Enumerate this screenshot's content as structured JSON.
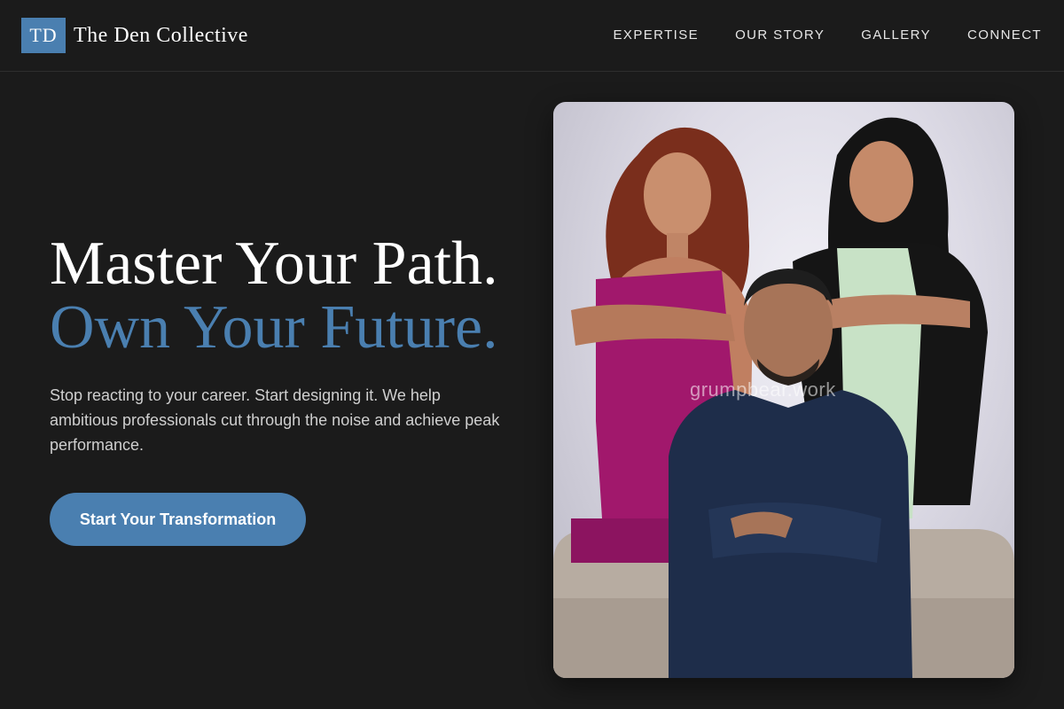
{
  "header": {
    "logo_text": "TD",
    "brand_name": "The Den Collective",
    "nav": [
      {
        "label": "EXPERTISE"
      },
      {
        "label": "OUR STORY"
      },
      {
        "label": "GALLERY"
      },
      {
        "label": "CONNECT"
      }
    ]
  },
  "hero": {
    "title_line1": "Master Your Path.",
    "title_line2": "Own Your Future.",
    "subtitle": "Stop reacting to your career. Start designing it. We help ambitious professionals cut through the noise and achieve peak performance.",
    "cta_label": "Start Your Transformation",
    "image": {
      "watermark": "grumpbear.work"
    }
  },
  "colors": {
    "background": "#1b1b1b",
    "accent": "#4a7fb0",
    "text": "#ffffff",
    "muted_text": "#cfcfcf"
  }
}
